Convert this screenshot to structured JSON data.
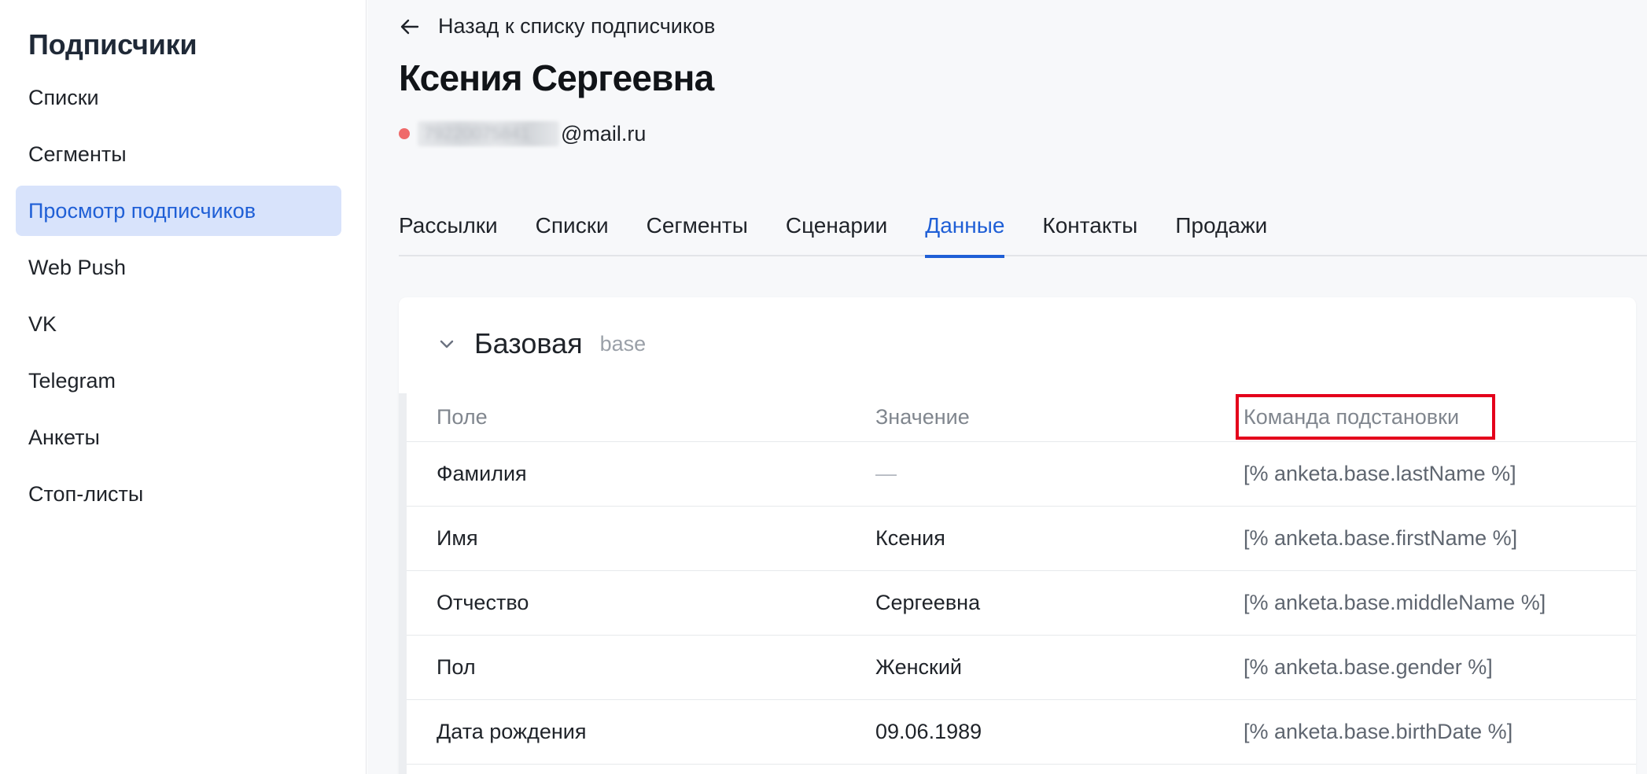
{
  "sidebar": {
    "title": "Подписчики",
    "items": [
      {
        "label": "Списки"
      },
      {
        "label": "Сегменты"
      },
      {
        "label": "Просмотр подписчиков",
        "active": true
      },
      {
        "label": "Web Push"
      },
      {
        "label": "VK"
      },
      {
        "label": "Telegram"
      },
      {
        "label": "Анкеты"
      },
      {
        "label": "Стоп-листы"
      }
    ]
  },
  "header": {
    "back_label": "Назад к списку подписчиков",
    "back_icon": "arrow-left-icon",
    "title": "Ксения Сергеевна",
    "email_visible_part": "@mail.ru",
    "email_status_color": "#ef6a6a"
  },
  "tabs": [
    {
      "label": "Рассылки"
    },
    {
      "label": "Списки"
    },
    {
      "label": "Сегменты"
    },
    {
      "label": "Сценарии"
    },
    {
      "label": "Данные",
      "active": true
    },
    {
      "label": "Контакты"
    },
    {
      "label": "Продажи"
    }
  ],
  "card": {
    "title": "Базовая",
    "subtitle": "base",
    "chevron_icon": "chevron-down-icon",
    "columns": {
      "field": "Поле",
      "value": "Значение",
      "command": "Команда подстановки"
    },
    "rows": [
      {
        "field": "Фамилия",
        "value": "—",
        "command": "[% anketa.base.lastName %]"
      },
      {
        "field": "Имя",
        "value": "Ксения",
        "command": "[% anketa.base.firstName %]"
      },
      {
        "field": "Отчество",
        "value": "Сергеевна",
        "command": "[% anketa.base.middleName %]"
      },
      {
        "field": "Пол",
        "value": "Женский",
        "command": "[% anketa.base.gender %]"
      },
      {
        "field": "Дата рождения",
        "value": "09.06.1989",
        "command": "[% anketa.base.birthDate %]"
      }
    ]
  },
  "colors": {
    "accent": "#1f5fd6",
    "active_nav_bg": "#d8e3fb",
    "highlight": "#e4001b"
  }
}
